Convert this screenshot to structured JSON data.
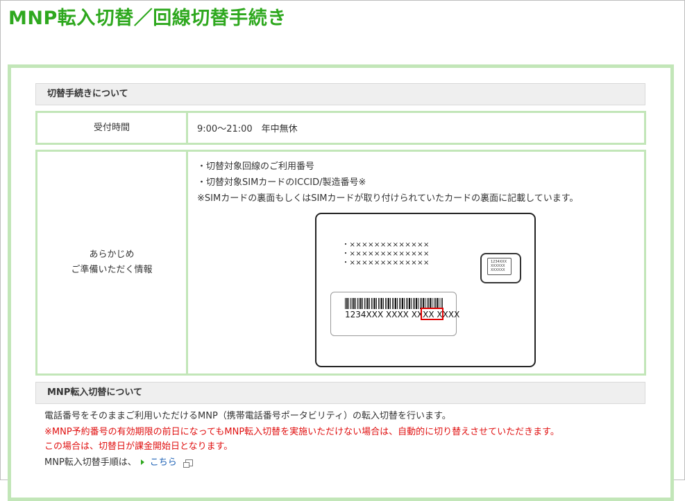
{
  "page_title": "MNP転入切替／回線切替手続き",
  "section1": {
    "heading": "切替手続きについて",
    "reception": {
      "label": "受付時間",
      "value": "9:00～21:00　年中無休"
    },
    "info": {
      "label_line1": "あらかじめ",
      "label_line2": "ご準備いただく情報",
      "items": [
        "・切替対象回線のご利用番号",
        "・切替対象SIMカードのICCID/製造番号※"
      ],
      "note": "※SIMカードの裏面もしくはSIMカードが取り付けられていたカードの裏面に記載しています。"
    },
    "card": {
      "x_rows": [
        "・×××××××××××××",
        "・×××××××××××××",
        "・×××××××××××××"
      ],
      "chip_lines": [
        "1234XXX",
        "XXXXXX",
        "XXXXXX"
      ],
      "iccid_text": "1234XXX XXXX XXXX XXXX"
    }
  },
  "section2": {
    "heading": "MNP転入切替について",
    "line1": "電話番号をそのままご利用いただけるMNP（携帯電話番号ポータビリティ）の転入切替を行います。",
    "red_line1": "※MNP予約番号の有効期限の前日になってもMNP転入切替を実施いただけない場合は、自動的に切り替えさせていただきます。",
    "red_line2": "この場合は、切替日が課金開始日となります。",
    "procedure_prefix": "MNP転入切替手順は、",
    "procedure_link": "こちら"
  },
  "colors": {
    "title_green": "#2ea81e",
    "border_green": "#c2e6b8",
    "warning_red": "#e01010",
    "link_blue": "#1a5fb4"
  }
}
